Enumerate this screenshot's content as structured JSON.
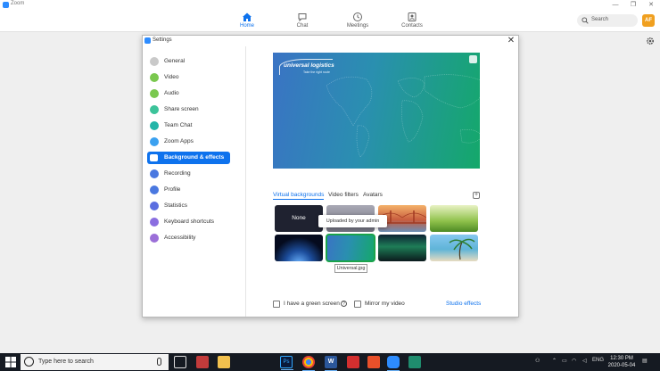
{
  "window": {
    "title": "Zoom",
    "minimize_label": "—",
    "maximize_label": "❐",
    "close_label": "✕"
  },
  "nav": {
    "tabs": [
      {
        "label": "Home",
        "icon": "home-icon",
        "active": true
      },
      {
        "label": "Chat",
        "icon": "chat-icon",
        "active": false
      },
      {
        "label": "Meetings",
        "icon": "clock-icon",
        "active": false
      },
      {
        "label": "Contacts",
        "icon": "contacts-icon",
        "active": false
      }
    ],
    "search_label": "Search",
    "avatar_initials": "AF"
  },
  "settings": {
    "title": "Settings",
    "close_label": "✕",
    "sidebar": [
      {
        "label": "General",
        "icon": "gear-icon",
        "color": "#c9c9c9"
      },
      {
        "label": "Video",
        "icon": "video-icon",
        "color": "#7ac84f"
      },
      {
        "label": "Audio",
        "icon": "headphones-icon",
        "color": "#7ac84f"
      },
      {
        "label": "Share screen",
        "icon": "share-screen-icon",
        "color": "#3cc39a"
      },
      {
        "label": "Team Chat",
        "icon": "chat-icon",
        "color": "#23b5a8"
      },
      {
        "label": "Zoom Apps",
        "icon": "apps-icon",
        "color": "#3ba1f0"
      },
      {
        "label": "Background & effects",
        "icon": "background-icon",
        "color": "#ffffff",
        "active": true
      },
      {
        "label": "Recording",
        "icon": "record-icon",
        "color": "#4a78e0"
      },
      {
        "label": "Profile",
        "icon": "profile-icon",
        "color": "#4a78e0"
      },
      {
        "label": "Statistics",
        "icon": "statistics-icon",
        "color": "#5b6ee0"
      },
      {
        "label": "Keyboard shortcuts",
        "icon": "keyboard-icon",
        "color": "#8a6ee0"
      },
      {
        "label": "Accessibility",
        "icon": "accessibility-icon",
        "color": "#9b6fd8"
      }
    ],
    "preview": {
      "logo_text": "universal logistics",
      "logo_tagline": "Take the right route"
    },
    "tabs": [
      {
        "label": "Virtual backgrounds",
        "active": true
      },
      {
        "label": "Video filters",
        "active": false
      },
      {
        "label": "Avatars",
        "active": false
      }
    ],
    "add_label": "+",
    "backgrounds": [
      {
        "label": "None",
        "kind": "none"
      },
      {
        "kind": "office"
      },
      {
        "kind": "golden-gate"
      },
      {
        "kind": "grass"
      },
      {
        "kind": "earth"
      },
      {
        "kind": "universal",
        "selected": true
      },
      {
        "kind": "aurora"
      },
      {
        "kind": "beach"
      }
    ],
    "tooltip": "Uploaded by your admin",
    "selected_filename": "Universal.jpg",
    "green_screen_label": "I have a green screen",
    "mirror_label": "Mirror my video",
    "help_label": "?",
    "studio_effects_label": "Studio effects"
  },
  "taskbar": {
    "search_placeholder": "Type here to search",
    "apps": [
      "task-view-icon",
      "snipping-icon",
      "file-explorer-icon",
      "photoshop-icon",
      "chrome-icon",
      "word-icon",
      "acrobat-icon",
      "office-icon",
      "zoom-icon",
      "app-icon"
    ],
    "photoshop_label": "Ps",
    "word_label": "W",
    "language": "ENG",
    "time": "12:30 PM",
    "date": "2020-05-04"
  },
  "colors": {
    "accent": "#0e72ed",
    "selected_outline": "#1aa34a",
    "taskbar": "#151a22"
  }
}
